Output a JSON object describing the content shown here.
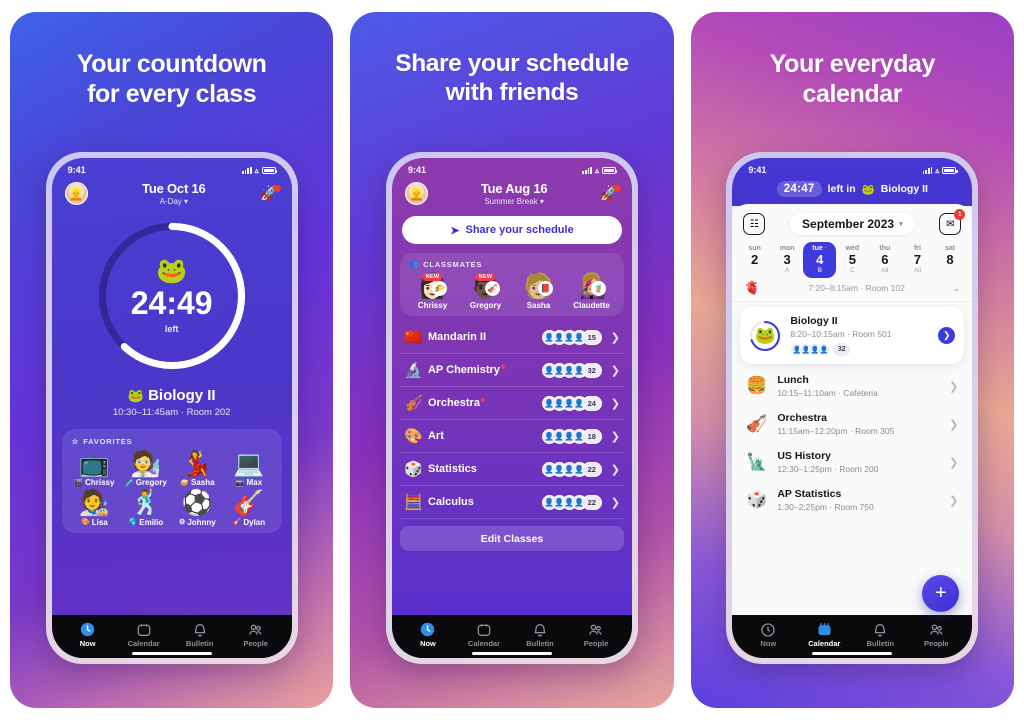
{
  "panels": [
    {
      "promo_title_line1": "Your countdown",
      "promo_title_line2": "for every class",
      "status": {
        "time": "9:41"
      },
      "nav": {
        "date": "Tue Oct 16",
        "subtitle": "A-Day ▾",
        "avatar_icon": "user-avatar",
        "rocket_icon": "rocket-icon"
      },
      "countdown": {
        "emoji": "🐸",
        "time": "24:49",
        "label": "left",
        "progress_pct": 62
      },
      "current_class": {
        "emoji": "🐸",
        "name": "Biology II",
        "meta": "10:30–11:45am · Room 202"
      },
      "favorites": {
        "header": "FAVORITES",
        "star_icon": "star-icon",
        "items": [
          {
            "emoji": "📺",
            "mini": "🎬",
            "name": "Chrissy"
          },
          {
            "emoji": "🧑‍🔬",
            "mini": "🧪",
            "name": "Gregory"
          },
          {
            "emoji": "💃",
            "mini": "🥪",
            "name": "Sasha"
          },
          {
            "emoji": "💻",
            "mini": "📷",
            "name": "Max"
          },
          {
            "emoji": "🧑‍🎨",
            "mini": "🎨",
            "name": "Lisa"
          },
          {
            "emoji": "🕺",
            "mini": "🌎",
            "name": "Emilio"
          },
          {
            "emoji": "⚽",
            "mini": "⚙",
            "name": "Johnny"
          },
          {
            "emoji": "🎸",
            "mini": "🎸",
            "name": "Dylan"
          }
        ]
      },
      "tabs": [
        {
          "label": "Now",
          "icon": "clock-icon",
          "active": true
        },
        {
          "label": "Calendar",
          "icon": "calendar-icon",
          "active": false
        },
        {
          "label": "Bulletin",
          "icon": "bell-icon",
          "active": false
        },
        {
          "label": "People",
          "icon": "people-icon",
          "active": false
        }
      ]
    },
    {
      "promo_title_line1": "Share your schedule",
      "promo_title_line2": "with friends",
      "status": {
        "time": "9:41"
      },
      "nav": {
        "date": "Tue Aug 16",
        "subtitle": "Summer Break ▾",
        "avatar_icon": "user-avatar",
        "rocket_icon": "rocket-icon"
      },
      "share_button": {
        "label": "Share your schedule",
        "icon": "share-arrow-icon"
      },
      "classmates": {
        "header": "CLASSMATES",
        "icon": "people-icon",
        "items": [
          {
            "emoji": "👩🏻",
            "sub": "🌮",
            "name": "Chrissy",
            "badge": "NEW"
          },
          {
            "emoji": "👨🏿",
            "sub": "🎻",
            "name": "Gregory",
            "badge": "NEW"
          },
          {
            "emoji": "🧑🏼",
            "sub": "📕",
            "name": "Sasha",
            "badge": ""
          },
          {
            "emoji": "👩🏼‍🎤",
            "sub": "🧋",
            "name": "Claudette",
            "badge": ""
          }
        ]
      },
      "classes": [
        {
          "emoji": "🇨🇳",
          "name": "Mandarin II",
          "count": "15",
          "unread": false
        },
        {
          "emoji": "🔬",
          "name": "AP Chemistry",
          "count": "32",
          "unread": true
        },
        {
          "emoji": "🎻",
          "name": "Orchestra",
          "count": "24",
          "unread": true
        },
        {
          "emoji": "🎨",
          "name": "Art",
          "count": "18",
          "unread": false
        },
        {
          "emoji": "🎲",
          "name": "Statistics",
          "count": "22",
          "unread": false
        },
        {
          "emoji": "🧮",
          "name": "Calculus",
          "count": "22",
          "unread": false
        }
      ],
      "edit_button": {
        "label": "Edit Classes"
      },
      "tabs": [
        {
          "label": "Now",
          "icon": "clock-icon",
          "active": true
        },
        {
          "label": "Calendar",
          "icon": "calendar-icon",
          "active": false
        },
        {
          "label": "Bulletin",
          "icon": "bell-icon",
          "active": false
        },
        {
          "label": "People",
          "icon": "people-icon",
          "active": false
        }
      ]
    },
    {
      "promo_title_line1": "Your everyday",
      "promo_title_line2": "calendar",
      "status": {
        "time": "9:41"
      },
      "banner": {
        "time": "24:47",
        "text": "left in",
        "emoji": "🐸",
        "class_name": "Biology II"
      },
      "toolbar": {
        "left_icon": "tasks-icon",
        "month": "September 2023",
        "month_carat": "▾",
        "inbox_icon": "inbox-icon",
        "inbox_badge": "1"
      },
      "week": [
        {
          "dow": "sun",
          "num": "2",
          "letter": "",
          "selected": false,
          "dot": false
        },
        {
          "dow": "mon",
          "num": "3",
          "letter": "A",
          "selected": false,
          "dot": false
        },
        {
          "dow": "tue",
          "num": "4",
          "letter": "B",
          "selected": true,
          "dot": true
        },
        {
          "dow": "wed",
          "num": "5",
          "letter": "C",
          "selected": false,
          "dot": false
        },
        {
          "dow": "thu",
          "num": "6",
          "letter": "All",
          "selected": false,
          "dot": false
        },
        {
          "dow": "fri",
          "num": "7",
          "letter": "All",
          "selected": false,
          "dot": false
        },
        {
          "dow": "sat",
          "num": "8",
          "letter": "",
          "selected": false,
          "dot": false
        }
      ],
      "previous_row": {
        "emoji": "🫀",
        "text": "7:20–8:15am · Room 102",
        "carat": "⌄"
      },
      "agenda_featured": {
        "emoji": "🐸",
        "name": "Biology II",
        "meta": "8:20–10:15am · Room 501",
        "count": "32",
        "progress_pct": 70,
        "go_icon": "chevron-right-icon"
      },
      "agenda": [
        {
          "emoji": "🍔",
          "name": "Lunch",
          "meta": "10:15–11:10am · Cafeteria"
        },
        {
          "emoji": "🎻",
          "name": "Orchestra",
          "meta": "11:15am–12:20pm · Room 305"
        },
        {
          "emoji": "🗽",
          "name": "US History",
          "meta": "12:30–1:25pm · Room 200"
        },
        {
          "emoji": "🎲",
          "name": "AP Statistics",
          "meta": "1:30–2:25pm · Room 750"
        }
      ],
      "fab": {
        "label": "+",
        "icon": "plus-icon"
      },
      "tabs": [
        {
          "label": "Now",
          "icon": "clock-icon",
          "active": false
        },
        {
          "label": "Calendar",
          "icon": "calendar-icon",
          "active": true
        },
        {
          "label": "Bulletin",
          "icon": "bell-icon",
          "active": false
        },
        {
          "label": "People",
          "icon": "people-icon",
          "active": false
        }
      ]
    }
  ],
  "colors": {
    "accent": "#3d3bdd",
    "badge_red": "#ee3b2f",
    "active_tab": "#2f8fe8"
  }
}
